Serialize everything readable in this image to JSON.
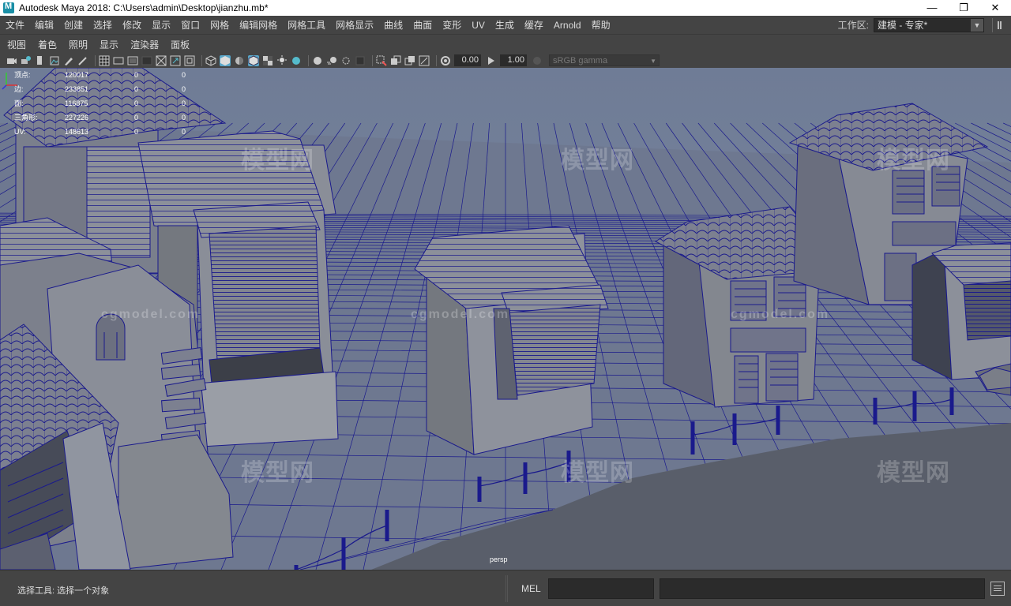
{
  "window": {
    "title": "Autodesk Maya 2018: C:\\Users\\admin\\Desktop\\jianzhu.mb*",
    "minimize": "—",
    "restore": "❐",
    "close": "✕"
  },
  "menubar": {
    "items": [
      "文件",
      "编辑",
      "创建",
      "选择",
      "修改",
      "显示",
      "窗口",
      "网格",
      "编辑网格",
      "网格工具",
      "网格显示",
      "曲线",
      "曲面",
      "变形",
      "UV",
      "生成",
      "缓存",
      "Arnold",
      "帮助"
    ],
    "workspace_label": "工作区:",
    "workspace_value": "建模 - 专家*"
  },
  "panel_menu": {
    "items": [
      "视图",
      "着色",
      "照明",
      "显示",
      "渲染器",
      "面板"
    ]
  },
  "panel_toolbar": {
    "exposure": "0.00",
    "gamma": "1.00",
    "color_space": "sRGB gamma"
  },
  "hud": {
    "rows": [
      {
        "label": "顶点:",
        "v1": "120017",
        "v2": "0",
        "v3": "0"
      },
      {
        "label": "边:",
        "v1": "233851",
        "v2": "0",
        "v3": "0"
      },
      {
        "label": "面:",
        "v1": "116875",
        "v2": "0",
        "v3": "0"
      },
      {
        "label": "三角形:",
        "v1": "227226",
        "v2": "0",
        "v3": "0"
      },
      {
        "label": "UV:",
        "v1": "148613",
        "v2": "0",
        "v3": "0"
      }
    ]
  },
  "viewport": {
    "camera": "persp",
    "watermark_cn": "模型网",
    "watermark_url": "cgmodel.com"
  },
  "bottom": {
    "help_line": "选择工具: 选择一个对象",
    "mel_label": "MEL"
  },
  "colors": {
    "wire": "#1a1a8c",
    "ground": "#6e7890",
    "building": "#8a8f99"
  }
}
